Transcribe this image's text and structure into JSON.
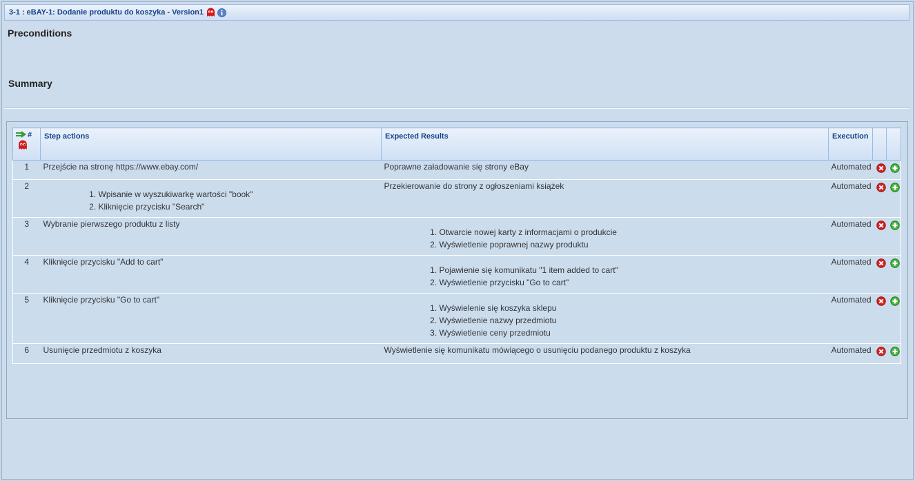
{
  "header": {
    "title": "3-1 : eBAY-1: Dodanie produktu do koszyka - Version1"
  },
  "sections": {
    "preconditions": "Preconditions",
    "summary": "Summary"
  },
  "table": {
    "col_num": "#",
    "col_actions": "Step actions",
    "col_results": "Expected Results",
    "col_execution": "Execution"
  },
  "steps": [
    {
      "num": "1",
      "action": "Przejście na stronę https://www.ebay.com/",
      "result": "Poprawne załadowanie się strony eBay",
      "execution": "Automated"
    },
    {
      "num": "2",
      "action_items": [
        "Wpisanie w wyszukiwarkę wartości \"book\"",
        "Kliknięcie przycisku \"Search\""
      ],
      "result": "Przekierowanie do strony z ogłoszeniami książek",
      "execution": "Automated"
    },
    {
      "num": "3",
      "action": "Wybranie pierwszego produktu z listy",
      "result_items": [
        "Otwarcie nowej karty z informacjami o produkcie",
        "Wyświetlenie poprawnej nazwy produktu"
      ],
      "execution": "Automated"
    },
    {
      "num": "4",
      "action": "Kliknięcie przycisku \"Add to cart\"",
      "result_items": [
        "Pojawienie się komunikatu \"1 item added to cart\"",
        "Wyświetlenie przycisku \"Go to cart\""
      ],
      "execution": "Automated"
    },
    {
      "num": "5",
      "action": "Kliknięcie przycisku \"Go to cart\"",
      "result_items": [
        "Wyświelenie się koszyka sklepu",
        "Wyświetlenie nazwy przedmiotu",
        "Wyświetlenie ceny przedmiotu"
      ],
      "execution": "Automated"
    },
    {
      "num": "6",
      "action": "Usunięcie przedmiotu z koszyka",
      "result": "Wyświetlenie się komunikatu mówiącego o usunięciu podanego produktu z koszyka",
      "execution": "Automated"
    }
  ],
  "colors": {
    "background": "#c7d8ea",
    "header_text": "#15428b",
    "delete_icon": "#d92020",
    "add_icon": "#3fa535"
  },
  "icons": [
    "ghost-icon",
    "info-icon",
    "reorder-icon",
    "delete-icon",
    "add-icon"
  ]
}
